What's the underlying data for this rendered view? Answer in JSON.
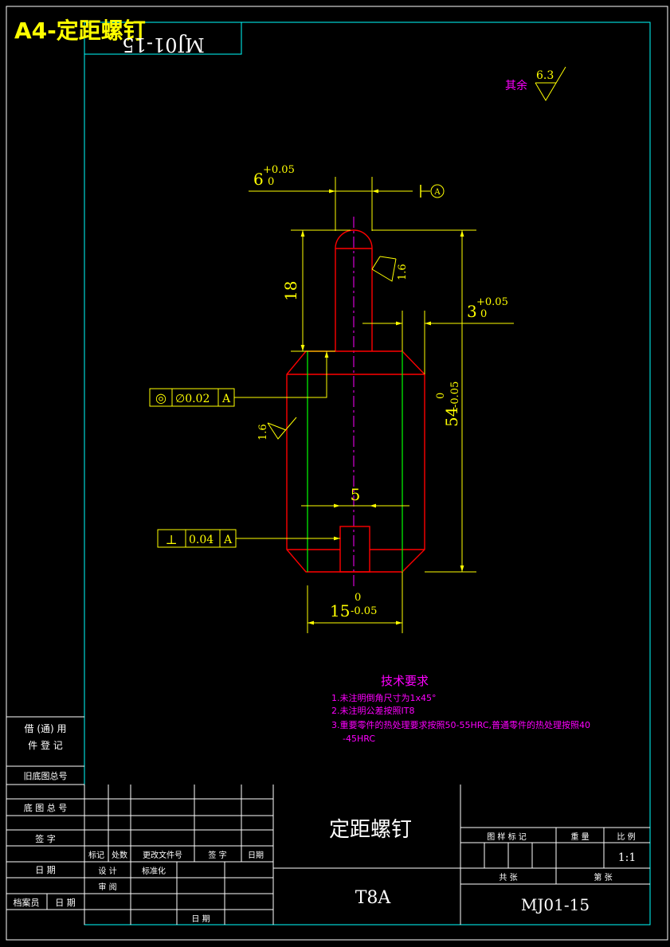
{
  "sheet": {
    "corner_title": "A4-定距螺钉",
    "mirrored_code": "MJ01-15"
  },
  "roughness": {
    "rest_label": "其余",
    "rest_value": "6.3",
    "top_value": "1.6",
    "side_value": "1.6"
  },
  "dimensions": {
    "d6_value": "6",
    "d6_upper": "+0.05",
    "d6_lower": "0",
    "d18": "18",
    "d3_value": "3",
    "d3_upper": "+0.05",
    "d3_lower": "0",
    "d54_value": "54",
    "d54_upper": "0",
    "d54_lower": "-0.05",
    "d5": "5",
    "d15_value": "15",
    "d15_upper": "0",
    "d15_lower": "-0.05"
  },
  "tolerances": {
    "datum_letter": "A",
    "concentricity_symbol": "◎",
    "concentricity_value": "∅0.02",
    "concentricity_datum": "A",
    "perpendicularity_symbol": "⊥",
    "perpendicularity_value": "0.04",
    "perpendicularity_datum": "A"
  },
  "tech": {
    "title": "技术要求",
    "line1": "1.未注明倒角尺寸为1x45°",
    "line2": "2.未注明公差按照IT8",
    "line3a": "3.重要零件的热处理要求按照50-55HRC,普通零件的热处理按照40",
    "line3b": "-45HRC"
  },
  "title_block": {
    "left_borrow": "借 (通) 用",
    "left_borrow2": "件 登 记",
    "left_old_no": "旧底图总号",
    "left_base_no": "底 图 总 号",
    "left_sign": "签    字",
    "left_date": "日    期",
    "left_archive": "档案员",
    "left_date2": "日 期",
    "col_mark": "标记",
    "col_count": "处数",
    "col_doc": "更改文件号",
    "col_sign": "签 字",
    "col_date": "日期",
    "design": "设 计",
    "standard": "标准化",
    "review": "审 阅",
    "date_label": "日 期",
    "part_name": "定距螺钉",
    "material": "T8A",
    "drawing_mark": "图 样 标 记",
    "weight": "重 量",
    "scale_label": "比 例",
    "scale_value": "1:1",
    "sheets_total": "共  张",
    "sheet_no": "第  张",
    "drawing_no": "MJ01-15"
  },
  "colors": {
    "border": "#00ffff",
    "outline": "#ff0000",
    "hidden": "#00ff00",
    "dimension": "#ffff00",
    "text": "#ffffff",
    "note": "#ff00ff",
    "center": "#ff00ff"
  }
}
